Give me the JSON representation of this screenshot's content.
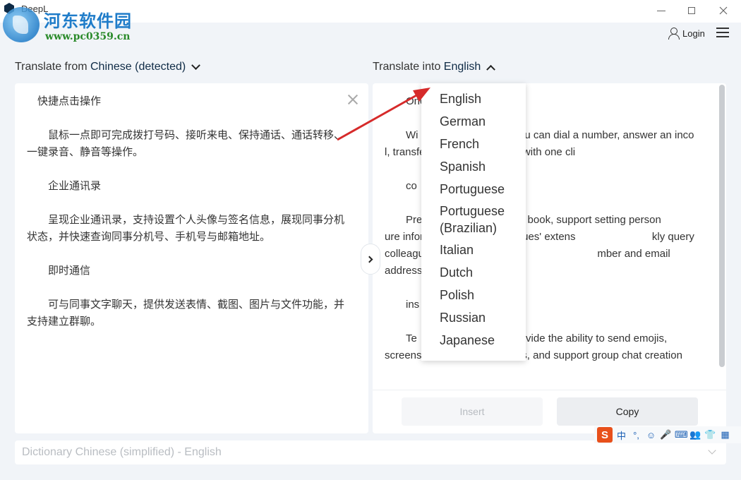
{
  "window": {
    "title": "DeepL"
  },
  "watermark": {
    "name": "河东软件园",
    "url": "www.pc0359.cn"
  },
  "header": {
    "login_label": "Login"
  },
  "source": {
    "prefix": "Translate from ",
    "language": "Chinese (detected)",
    "text": "　快捷点击操作\n\n　　鼠标一点即可完成拨打号码、接听来电、保持通话、通话转移、一键录音、静音等操作。\n\n　　企业通讯录\n\n　　呈现企业通讯录，支持设置个人头像与签名信息，展现同事分机状态，并快速查询同事分机号、手机号与邮箱地址。\n\n　　即时通信\n\n　　可与同事文字聊天，提供发送表情、截图、图片与文件功能，并支持建立群聊。"
  },
  "target": {
    "prefix": "Translate into ",
    "language": "English",
    "text": "　　Onc\n\n　　Wi                          ick, you can dial a number, answer an inco                          l, transfer a call, record a call with one cli\n\n　　co\n\n　　Pre                          dress book, support setting person                          ure information, show colleagues' extens                          kly query colleagues' extension numbe                          mber and email address.\n\n　　ins\n\n　　Te                          es, provide the ability to send emojis, screenshots, pictures and files, and support group chat creation",
    "insert_label": "Insert",
    "copy_label": "Copy"
  },
  "dropdown": {
    "options": [
      "English",
      "German",
      "French",
      "Spanish",
      "Portuguese",
      "Portuguese\n(Brazilian)",
      "Italian",
      "Dutch",
      "Polish",
      "Russian",
      "Japanese"
    ]
  },
  "dictionary": {
    "label": "Dictionary Chinese (simplified) - English"
  },
  "ime": {
    "logo": "S",
    "items": [
      "中",
      "°,",
      "☺",
      "🎤",
      "⌨",
      "👥",
      "👕",
      "▦"
    ]
  },
  "colors": {
    "background": "#f1f4f8",
    "accent_navy": "#0f2b46",
    "arrow": "#d62a2a"
  }
}
